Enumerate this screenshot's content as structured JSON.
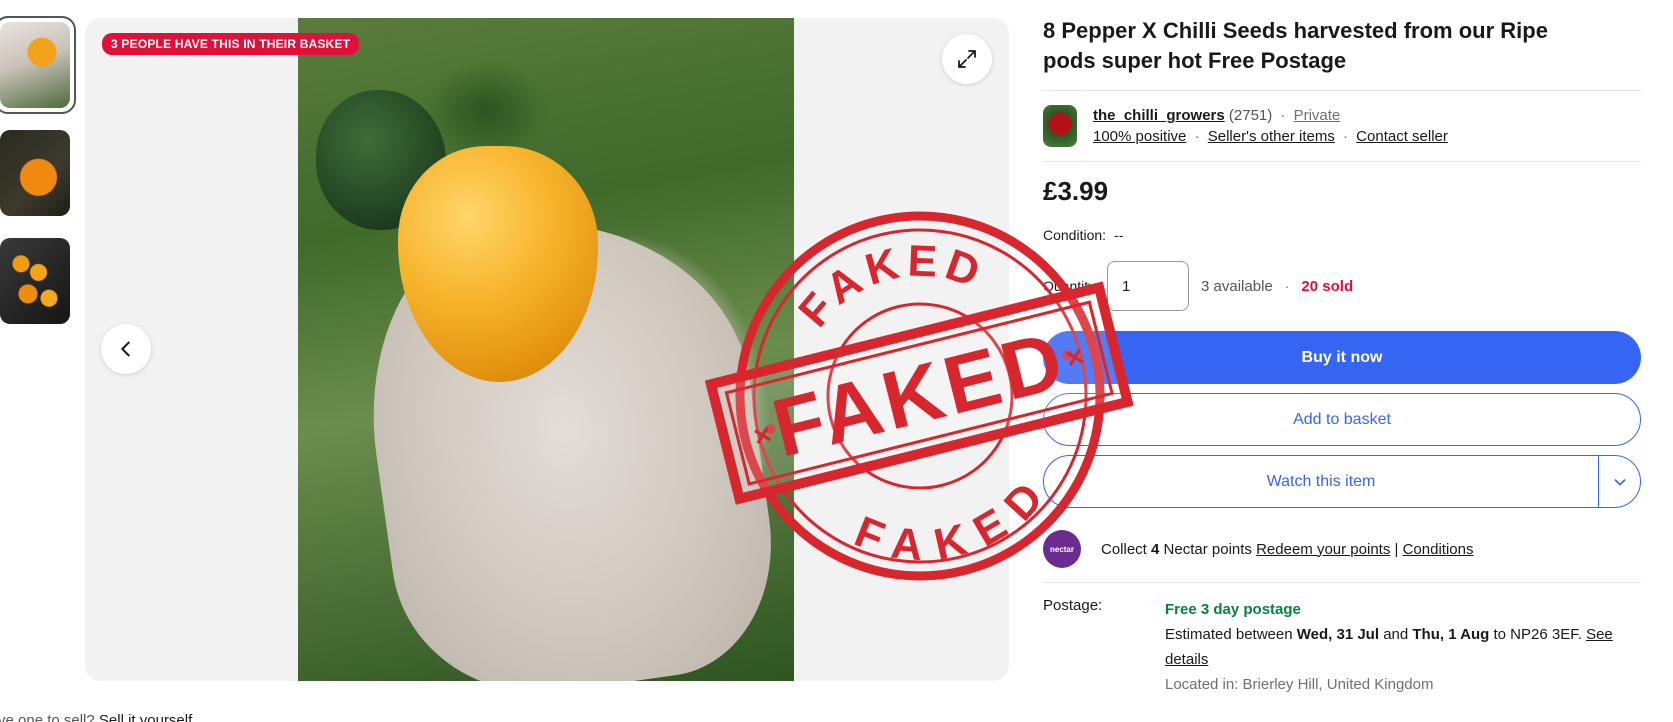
{
  "gallery": {
    "badge_text": "3 PEOPLE HAVE THIS IN THEIR BASKET",
    "thumbnails": [
      {
        "alt": "yellow pepper in hand"
      },
      {
        "alt": "orange pepper on plant"
      },
      {
        "alt": "pile of orange peppers"
      }
    ],
    "icons": {
      "expand": "expand-icon",
      "previous": "chevron-left-icon"
    }
  },
  "listing": {
    "title": "8 Pepper X Chilli Seeds harvested from our Ripe pods super hot Free Postage",
    "seller": {
      "name": "the_chilli_growers",
      "feedback_count": "(2751)",
      "type": "Private",
      "positive": "100% positive",
      "other_items": "Seller's other items",
      "contact": "Contact seller"
    },
    "price": "£3.99",
    "condition_label": "Condition:",
    "condition_value": "--",
    "quantity_label": "Quantity:",
    "quantity_value": "1",
    "available": "3 available",
    "sold": "20 sold",
    "buy_now": "Buy it now",
    "add_to_basket": "Add to basket",
    "watch": "Watch this item"
  },
  "nectar": {
    "logo_text": "nectar",
    "collect_prefix": "Collect",
    "points": "4",
    "collect_suffix": "Nectar points",
    "redeem": "Redeem your points",
    "separator": "|",
    "conditions": "Conditions"
  },
  "postage": {
    "label": "Postage:",
    "free": "Free 3 day postage",
    "est_prefix": "Estimated between",
    "date1": "Wed, 31 Jul",
    "and": "and",
    "date2": "Thu, 1 Aug",
    "dest": "to NP26 3EF.",
    "see_details": "See details",
    "located": "Located in: Brierley Hill, United Kingdom"
  },
  "footer": {
    "prefix": "ve one to sell?",
    "link": "Sell it yourself"
  },
  "stamp": {
    "text_top": "FAKED",
    "text_center": "FAKED",
    "text_bottom": "FAKED",
    "color": "#d8262e"
  },
  "colors": {
    "accent": "#3665f3",
    "badge": "#e0103a",
    "free_postage": "#05823f"
  }
}
